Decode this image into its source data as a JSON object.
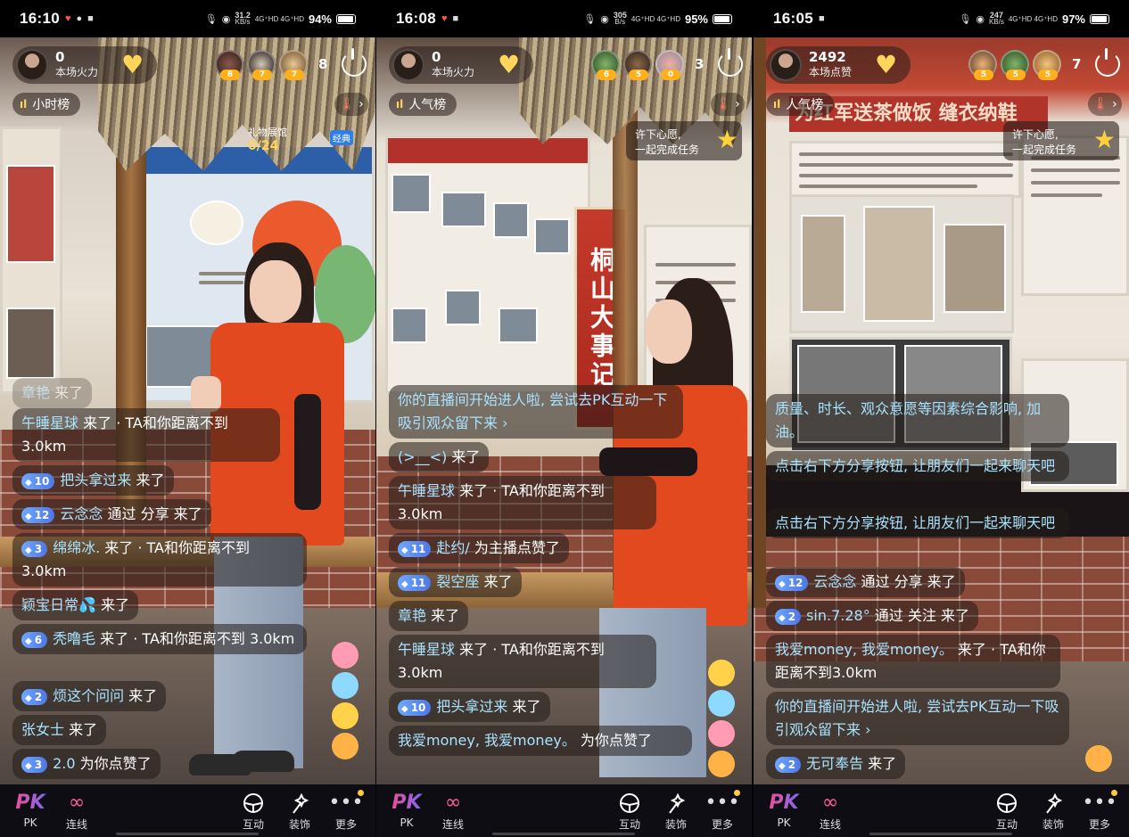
{
  "panels": [
    {
      "status": {
        "time": "16:10",
        "speed": "31.2",
        "speed_unit": "KB/s",
        "net": "4G⁺HD 4G⁺HD",
        "battery": "94%"
      },
      "host": {
        "count": "0",
        "label": "本场火力"
      },
      "viewer_levels": [
        "8",
        "7",
        "7"
      ],
      "viewer_count": "8",
      "rank_label": "小时榜",
      "gift": {
        "label": "礼物展馆",
        "count": "0/24",
        "tag": "经典"
      },
      "chat": [
        {
          "user": "章艳",
          "text": " 来了"
        },
        {
          "user": "午睡星球",
          "text": " 来了 · TA和你距离不到 3.0km"
        },
        {
          "level": "10",
          "user": "把头拿过来",
          "text": " 来了"
        },
        {
          "level": "12",
          "user": "云念念",
          "text": " 通过 分享 来了"
        },
        {
          "level": "3",
          "user": "绵绵冰.",
          "text": " 来了 · TA和你距离不到 3.0km"
        },
        {
          "user": "颖宝日常💦",
          "text": " 来了"
        },
        {
          "level": "6",
          "user": "秃噜毛",
          "text": " 来了 · TA和你距离不到 3.0km"
        },
        {
          "level": "2",
          "user": "烦这个问问",
          "text": " 来了"
        },
        {
          "user": "张女士",
          "text": " 来了"
        },
        {
          "level": "3",
          "user": "2.0",
          "text": " 为你点赞了"
        }
      ]
    },
    {
      "status": {
        "time": "16:08",
        "speed": "305",
        "speed_unit": "B/s",
        "net": "4G⁺HD 4G⁺HD",
        "battery": "95%"
      },
      "host": {
        "count": "0",
        "label": "本场火力"
      },
      "viewer_levels": [
        "6",
        "5",
        "0"
      ],
      "viewer_count": "3",
      "rank_label": "人气榜",
      "wish": {
        "line1": "许下心愿,",
        "line2": "一起完成任务"
      },
      "sign_text": "桐山大事记",
      "chat": [
        {
          "user": "你的直播间开始进人啦, 尝试去PK互动一下吸引观众留下来 ›",
          "text": ""
        },
        {
          "user": "(>__<)",
          "text": " 来了"
        },
        {
          "user": "午睡星球",
          "text": " 来了 · TA和你距离不到 3.0km"
        },
        {
          "level": "11",
          "user": "赴约/",
          "text": " 为主播点赞了"
        },
        {
          "level": "11",
          "user": "裂空座",
          "text": " 来了"
        },
        {
          "user": "章艳",
          "text": " 来了"
        },
        {
          "user": "午睡星球",
          "text": " 来了 · TA和你距离不到 3.0km"
        },
        {
          "level": "10",
          "user": "把头拿过来",
          "text": " 来了"
        },
        {
          "user": "我爱money, 我爱money。",
          "text": " 为你点赞了"
        }
      ]
    },
    {
      "status": {
        "time": "16:05",
        "speed": "247",
        "speed_unit": "KB/s",
        "net": "4G⁺HD 4G⁺HD",
        "battery": "97%"
      },
      "host": {
        "count": "2492",
        "label": "本场点赞"
      },
      "viewer_levels": [
        "5",
        "5",
        "5"
      ],
      "viewer_count": "7",
      "rank_label": "人气榜",
      "wish": {
        "line1": "许下心愿,",
        "line2": "一起完成任务"
      },
      "banner": "为红军送茶做饭 缝衣纳鞋",
      "chat": [
        {
          "user": "质量、时长、观众意愿等因素综合影响, 加油。",
          "text": ""
        },
        {
          "user": "点击右下方分享按钮, 让朋友们一起来聊天吧",
          "text": ""
        },
        {
          "user": "点击右下方分享按钮, 让朋友们一起来聊天吧",
          "text": ""
        },
        {
          "level": "12",
          "user": "云念念",
          "text": " 通过 分享 来了"
        },
        {
          "level": "2",
          "user": "sin.7.28°",
          "text": " 通过 关注 来了"
        },
        {
          "user": "我爱money, 我爱money。",
          "text": " 来了 · TA和你距离不到3.0km"
        },
        {
          "user": "你的直播间开始进人啦, 尝试去PK互动一下吸引观众留下来 ›",
          "text": ""
        },
        {
          "level": "2",
          "user": "无可奉告",
          "text": " 来了"
        }
      ]
    }
  ],
  "toolbar": {
    "pk": "PK",
    "pk_sub": "PK",
    "link": "连线",
    "interact": "互动",
    "decorate": "装饰",
    "more": "更多"
  },
  "colors": {
    "accent_name": "#a8e3ff",
    "level_badge": "#5b8cf0",
    "shirt": "#e2491f"
  }
}
